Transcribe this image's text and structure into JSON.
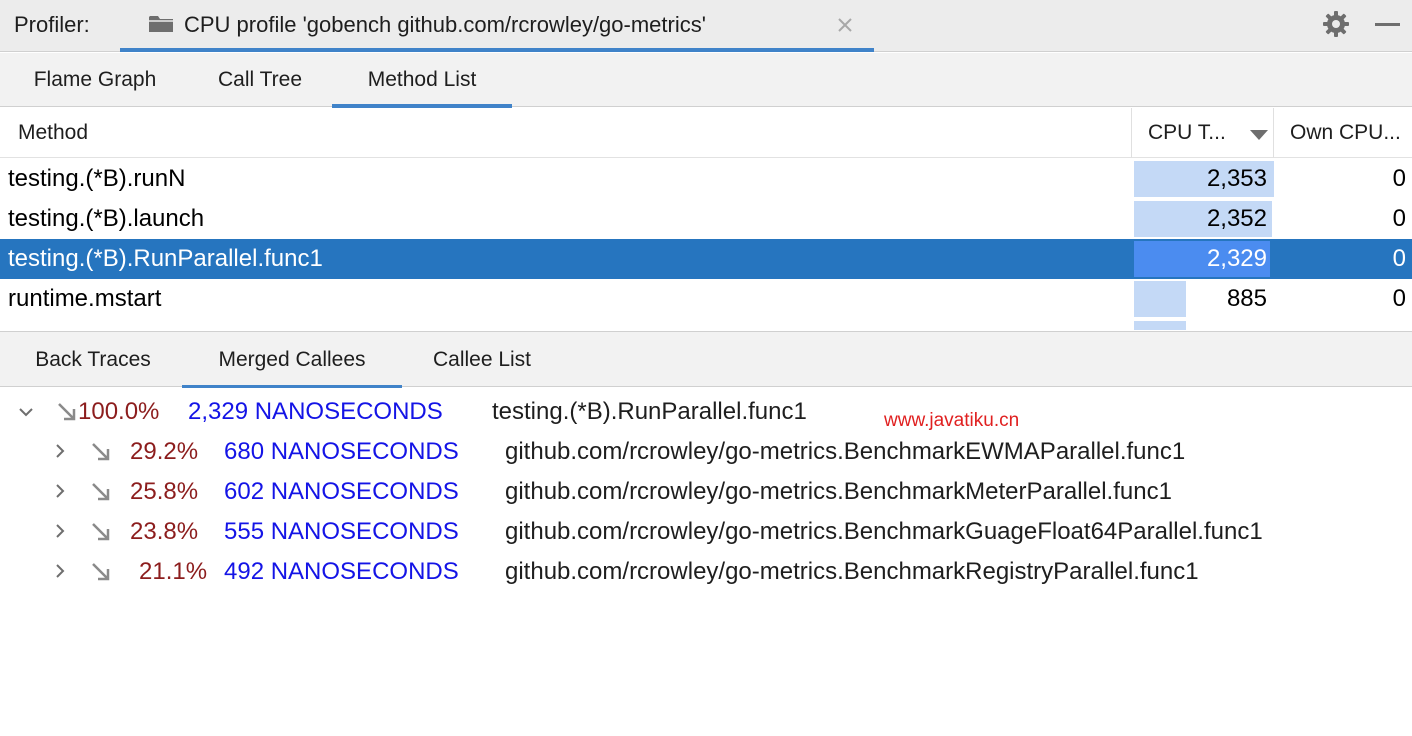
{
  "profiler": {
    "label": "Profiler:",
    "tab_title": "CPU profile 'gobench github.com/rcrowley/go-metrics'"
  },
  "view_tabs": [
    {
      "label": "Flame Graph",
      "active": false
    },
    {
      "label": "Call Tree",
      "active": false
    },
    {
      "label": "Method List",
      "active": true
    }
  ],
  "table": {
    "columns": [
      "Method",
      "CPU T...",
      "Own CPU..."
    ],
    "sort_column": "CPU T...",
    "sort_direction": "descending",
    "rows": [
      {
        "method": "testing.(*B).runN",
        "cpu": "2,353",
        "own": "0",
        "cpu_fraction": 1.0,
        "selected": false
      },
      {
        "method": "testing.(*B).launch",
        "cpu": "2,352",
        "own": "0",
        "cpu_fraction": 0.9996,
        "selected": false
      },
      {
        "method": "testing.(*B).RunParallel.func1",
        "cpu": "2,329",
        "own": "0",
        "cpu_fraction": 0.99,
        "selected": true
      },
      {
        "method": "runtime.mstart",
        "cpu": "885",
        "own": "0",
        "cpu_fraction": 0.376,
        "selected": false
      }
    ]
  },
  "bottom_tabs": [
    {
      "label": "Back Traces",
      "active": false
    },
    {
      "label": "Merged Callees",
      "active": true
    },
    {
      "label": "Callee List",
      "active": false
    }
  ],
  "callees": {
    "root": {
      "percent": "100.0%",
      "time": "2,329 NANOSECONDS",
      "name": "testing.(*B).RunParallel.func1",
      "expanded": true
    },
    "children": [
      {
        "percent": "29.2%",
        "time": "680 NANOSECONDS",
        "name": "github.com/rcrowley/go-metrics.BenchmarkEWMAParallel.func1",
        "expanded": false
      },
      {
        "percent": "25.8%",
        "time": "602 NANOSECONDS",
        "name": "github.com/rcrowley/go-metrics.BenchmarkMeterParallel.func1",
        "expanded": false
      },
      {
        "percent": "23.8%",
        "time": "555 NANOSECONDS",
        "name": "github.com/rcrowley/go-metrics.BenchmarkGuageFloat64Parallel.func1",
        "expanded": false
      },
      {
        "percent": "21.1%",
        "time": "492 NANOSECONDS",
        "name": "github.com/rcrowley/go-metrics.BenchmarkRegistryParallel.func1",
        "expanded": false
      }
    ]
  },
  "watermark": "www.javatiku.cn",
  "colors": {
    "accent": "#4083c9",
    "selection": "#2675bf",
    "cpu_bar": "#c4d9f6",
    "percent": "#8c1d1d",
    "time": "#1414e6",
    "watermark": "#e02020"
  },
  "icons": {
    "tab": "folder-icon",
    "tab_close": "close-icon",
    "settings": "gear-icon",
    "hide": "minimize-icon",
    "expanded": "chevron-down-icon",
    "collapsed": "chevron-right-icon",
    "callee": "arrow-down-right-icon"
  }
}
